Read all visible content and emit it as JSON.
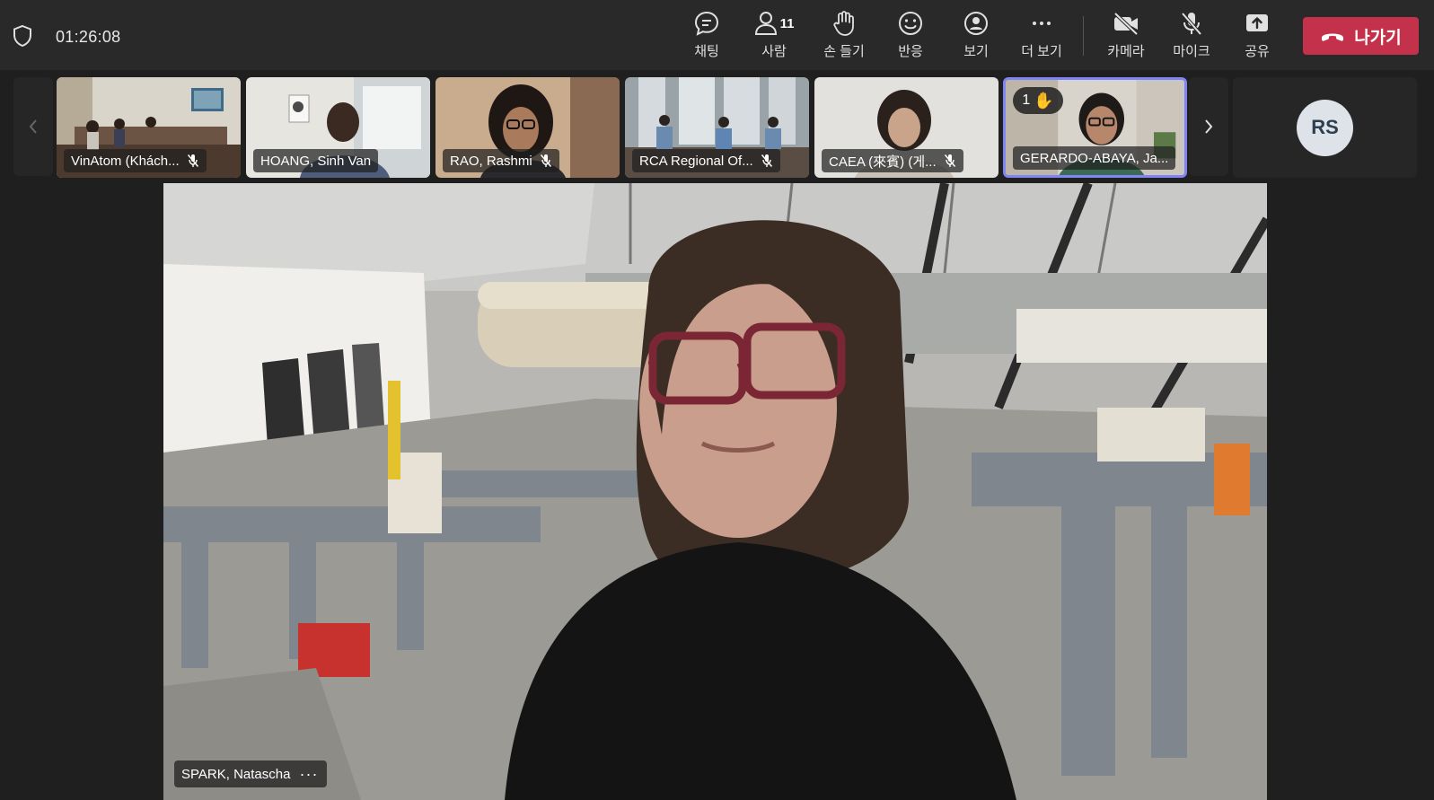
{
  "topbar": {
    "timer": "01:26:08",
    "people_count": "11",
    "buttons": {
      "chat": "채팅",
      "people": "사람",
      "raise_hand": "손 들기",
      "react": "반응",
      "view": "보기",
      "more": "더 보기",
      "camera": "카메라",
      "mic": "마이크",
      "share": "공유"
    },
    "leave_label": "나가기",
    "colors": {
      "leave": "#c4314b",
      "bar": "#292929"
    }
  },
  "thumbnails": [
    {
      "name": "VinAtom (Khách...",
      "muted": true
    },
    {
      "name": "HOANG, Sinh Van",
      "muted": false
    },
    {
      "name": "RAO, Rashmi",
      "muted": true
    },
    {
      "name": "RCA Regional Of...",
      "muted": true
    },
    {
      "name": "CAEA (來賓) (게...",
      "muted": true
    },
    {
      "name": "GERARDO-ABAYA, Ja...",
      "muted": false,
      "active": true,
      "hand_count": "1"
    }
  ],
  "avatar_tile": {
    "initials": "RS"
  },
  "stage": {
    "speaker_name": "SPARK, Natascha",
    "more": "···"
  },
  "accent_color": "#7f85f5"
}
